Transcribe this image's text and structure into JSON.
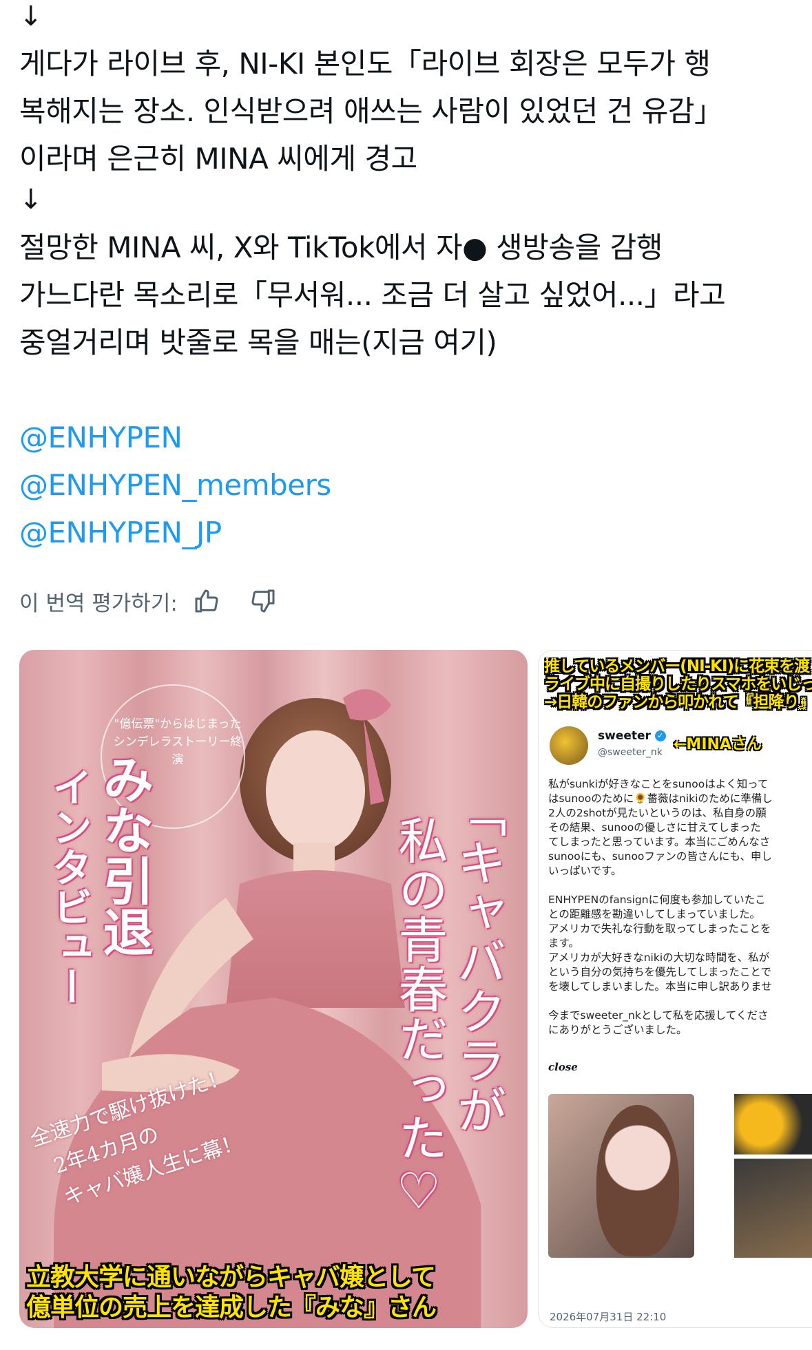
{
  "tweet": {
    "arrow1": "↓",
    "line1": "게다가 라이브 후, NI-KI 본인도「라이브 회장은 모두가 행",
    "line2": "복해지는 장소. 인식받으려 애쓰는 사람이 있었던 건 유감」",
    "line3": "이라며 은근히 MINA 씨에게 경고",
    "arrow2": "↓",
    "line4": "절망한 MINA 씨, X와 TikTok에서 자● 생방송을 감행",
    "line5": "가느다란 목소리로「무서워... 조금 더 살고 싶었어...」라고",
    "line6": "중얼거리며 밧줄로 목을 매는(지금 여기)",
    "mentions": [
      "@ENHYPEN",
      "@ENHYPEN_members",
      "@ENHYPEN_JP"
    ]
  },
  "translate": {
    "label": "이 번역 평가하기:",
    "thumbs_up_icon": "thumbs-up-icon",
    "thumbs_down_icon": "thumbs-down-icon"
  },
  "media_left": {
    "badge_small": "\"億伝票\"からはじまった",
    "badge_small2": "シンデレラストーリー終演",
    "title_vertical_1": "みな引退",
    "title_vertical_2": "インタビュー",
    "quote_vertical_1": "「キャバクラが",
    "quote_vertical_2": "私の青春だった♡",
    "sub1": "全速力で駆け抜けた！",
    "sub2": "2年4カ月の",
    "sub3": "キャバ嬢人生に幕！",
    "caption1": "立教大学に通いながらキャバ嬢として",
    "caption2": "億単位の売上を達成した『みな』さん"
  },
  "media_right": {
    "header1": "推しているメンバー(NI-KI)に花束を渡",
    "header2": "ライブ中に自撮りしたりスマホをいじっ",
    "header3": "→日韓のファンから叩かれて『担降り』",
    "account_name": "sweeter",
    "account_handle": "@sweeter_nk",
    "annotation": "←MINAさん",
    "body": [
      "私がsunkiが好きなことをsunooはよく知って",
      "はsunooのために🌻薔薇はnikiのために準備し",
      "2人の2shotが見たいというのは、私自身の願",
      "その結果、sunooの優しさに甘えてしまった",
      "てしまったと思っています。本当にごめんなさ",
      "sunooにも、sunooファンの皆さんにも、申し",
      "いっぱいです。",
      "",
      "ENHYPENのfansignに何度も参加していたこ",
      "との距離感を勘違いしてしまっていました。",
      "アメリカで失礼な行動を取ってしまったことを",
      "ます。",
      "アメリカが大好きなnikiの大切な時間を、私が",
      "という自分の気持ちを優先してしまったことで",
      "を壊してしまいました。本当に申し訳ありませ",
      "",
      "今までsweeter_nkとして私を応援してくださ",
      "にありがとうございました。"
    ],
    "close_label": "close",
    "timestamp": "2026年07月31日 22:10"
  },
  "colors": {
    "text": "#0f1419",
    "mention": "#1d9bf0",
    "secondary": "#536471",
    "pink_bg": "#d9a0a4"
  }
}
